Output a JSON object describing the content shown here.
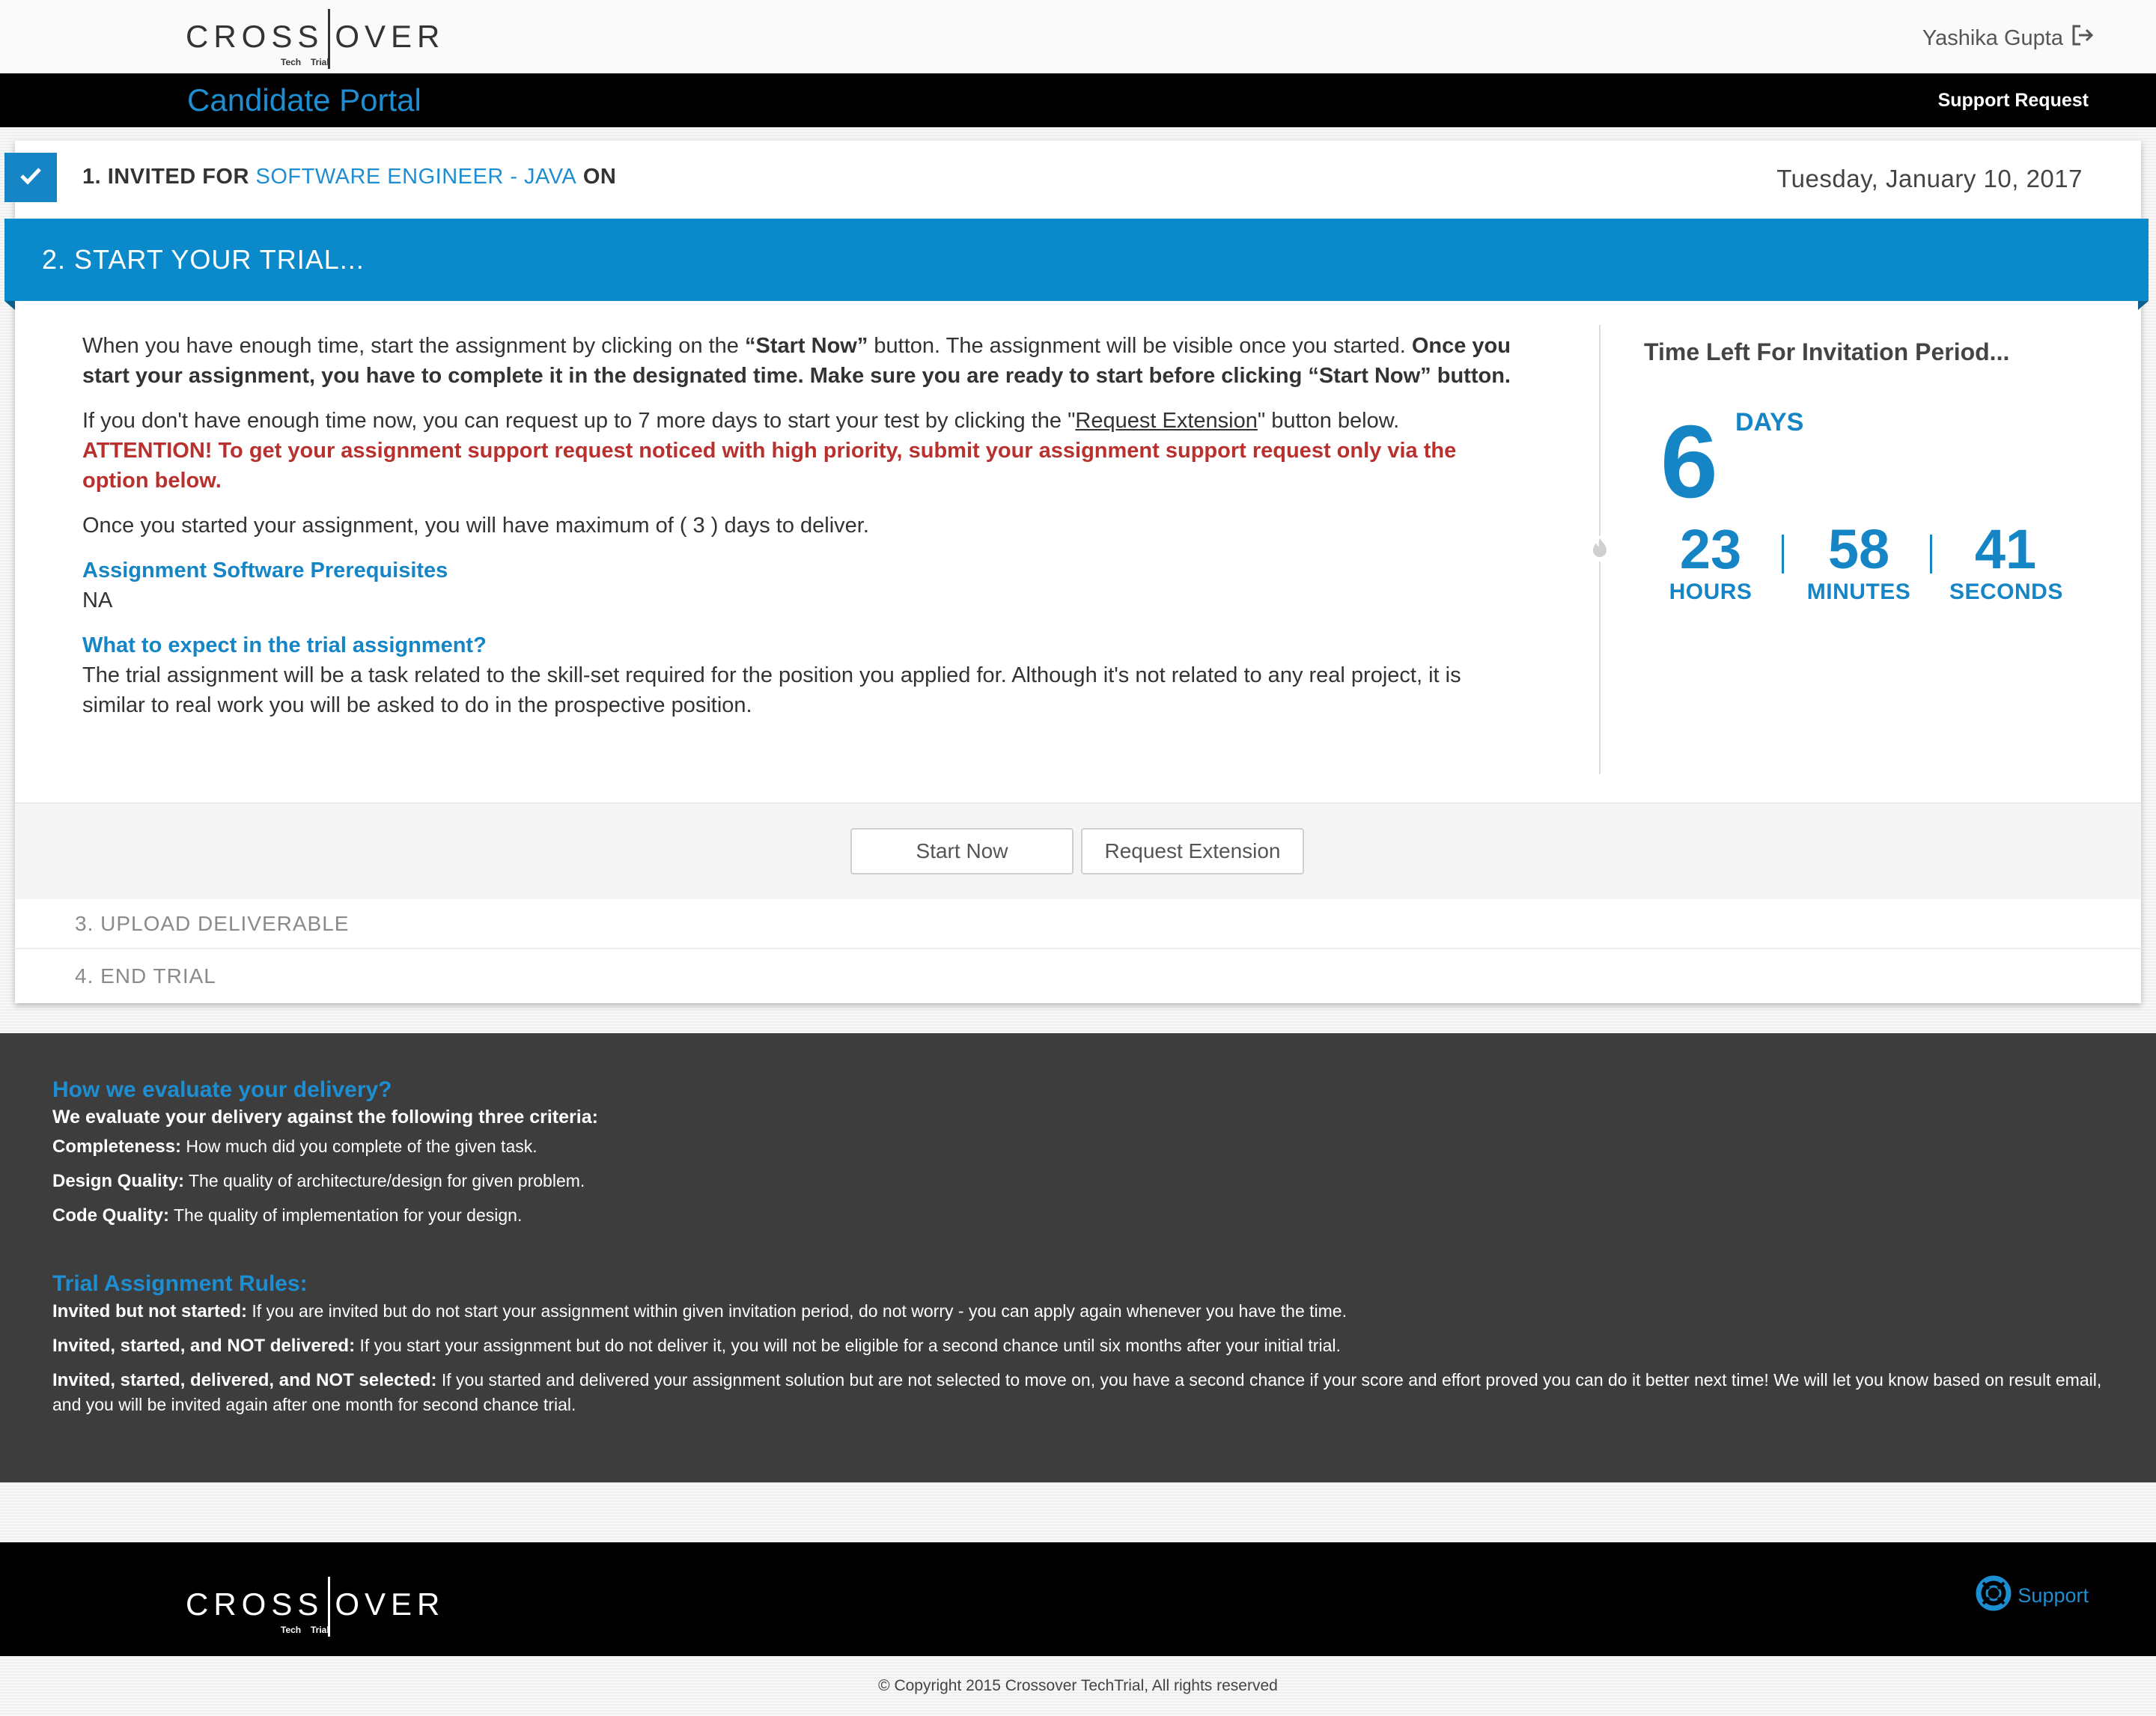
{
  "header": {
    "logo_text_left": "CROSS",
    "logo_text_right": "OVER",
    "logo_sub_left": "Tech",
    "logo_sub_right": "Trial",
    "user_name": "Yashika Gupta",
    "portal_title": "Candidate Portal",
    "support_request": "Support Request"
  },
  "steps": {
    "step1": {
      "prefix": "1. INVITED FOR",
      "job": "SOFTWARE ENGINEER - JAVA",
      "suffix": "ON",
      "date": "Tuesday, January 10, 2017"
    },
    "step2": {
      "title": "2. START YOUR TRIAL...",
      "para1_a": "When you have enough time, start the assignment by clicking on the ",
      "para1_b": "“Start Now”",
      "para1_c": " button. The assignment will be visible once you started. ",
      "para1_d": "Once you start your assignment, you have to complete it in the designated time. Make sure you are ready to start before clicking “Start Now” button.",
      "para2_a": "If you don't have enough time now, you can request up to 7 more days to start your test by clicking the \"",
      "para2_link": "Request Extension",
      "para2_b": "\" button below. ",
      "para2_red": "ATTENTION! To get your assignment support request noticed with high priority, submit your assignment support request only via the option below.",
      "para3": "Once you started your assignment, you will have maximum of ( 3 ) days to deliver.",
      "prereq_title": "Assignment Software Prerequisites",
      "prereq_value": "NA",
      "expect_title": "What to expect in the trial assignment?",
      "expect_text": "The trial assignment will be a task related to the skill-set required for the position you applied for. Although it's not related to any real project, it is similar to real work you will be asked to do in the prospective position."
    },
    "timer": {
      "title": "Time Left For Invitation Period...",
      "days": "6",
      "days_label": "DAYS",
      "hours": "23",
      "hours_label": "HOURS",
      "minutes": "58",
      "minutes_label": "MINUTES",
      "seconds": "41",
      "seconds_label": "SECONDS"
    },
    "buttons": {
      "start_now": "Start Now",
      "request_extension": "Request Extension"
    },
    "step3": "3. UPLOAD DELIVERABLE",
    "step4": "4. END TRIAL"
  },
  "info": {
    "eval_title": "How we evaluate your delivery?",
    "eval_lead": "We evaluate your delivery against the following three criteria:",
    "criteria": [
      {
        "label": "Completeness:",
        "text": " How much did you complete of the given task."
      },
      {
        "label": "Design Quality:",
        "text": " The quality of architecture/design for given problem."
      },
      {
        "label": "Code Quality:",
        "text": " The quality of implementation for your design."
      }
    ],
    "rules_title": "Trial Assignment Rules:",
    "rules": [
      {
        "label": "Invited but not started:",
        "text": " If you are invited but do not start your assignment within given invitation period, do not worry - you can apply again whenever you have the time."
      },
      {
        "label": "Invited, started, and NOT delivered:",
        "text": " If you start your assignment but do not deliver it, you will not be eligible for a second chance until six months after your initial trial."
      },
      {
        "label": "Invited, started, delivered, and NOT selected:",
        "text": " If you started and delivered your assignment solution but are not selected to move on, you have a second chance if your score and effort proved you can do it better next time! We will let you know based on result email, and you will be invited again after one month for second chance trial."
      }
    ]
  },
  "footer": {
    "support": "Support",
    "copyright": "© Copyright 2015 Crossover TechTrial, All rights reserved"
  },
  "colors": {
    "accent": "#1585c6",
    "step_bar": "#0a8acb",
    "attention": "#b8312f",
    "dark_band": "#3d3d3d"
  },
  "icons": [
    "check-icon",
    "logout-icon",
    "fire-icon",
    "lifebuoy-icon"
  ]
}
